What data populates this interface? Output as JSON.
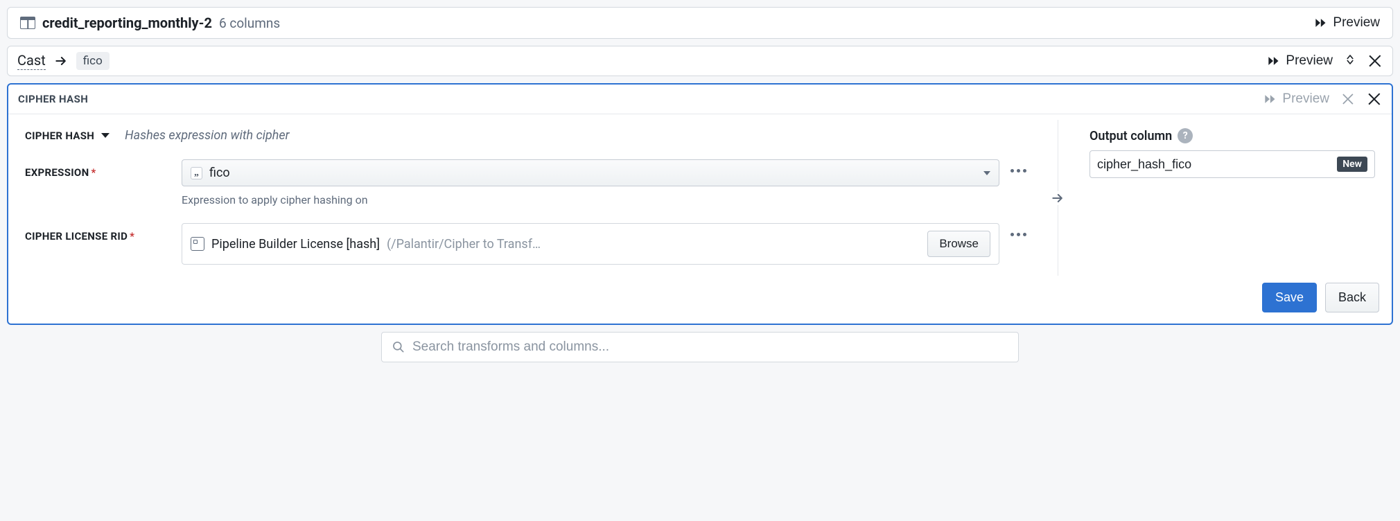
{
  "dataset": {
    "name": "credit_reporting_monthly-2",
    "columns_text": "6 columns",
    "preview_label": "Preview"
  },
  "cast": {
    "label": "Cast",
    "column_chip": "fico",
    "preview_label": "Preview"
  },
  "cipher": {
    "panel_title": "CIPHER HASH",
    "preview_label": "Preview",
    "function_name": "CIPHER HASH",
    "function_description": "Hashes expression with cipher",
    "expression": {
      "label": "EXPRESSION",
      "value": "fico",
      "help": "Expression to apply cipher hashing on"
    },
    "license": {
      "label": "CIPHER LICENSE RID",
      "name": "Pipeline Builder License [hash]",
      "path": "(/Palantir/Cipher to Transf…",
      "browse_label": "Browse"
    },
    "output": {
      "label": "Output column",
      "value": "cipher_hash_fico",
      "new_badge": "New"
    },
    "actions": {
      "save": "Save",
      "back": "Back"
    }
  },
  "search": {
    "placeholder": "Search transforms and columns..."
  }
}
